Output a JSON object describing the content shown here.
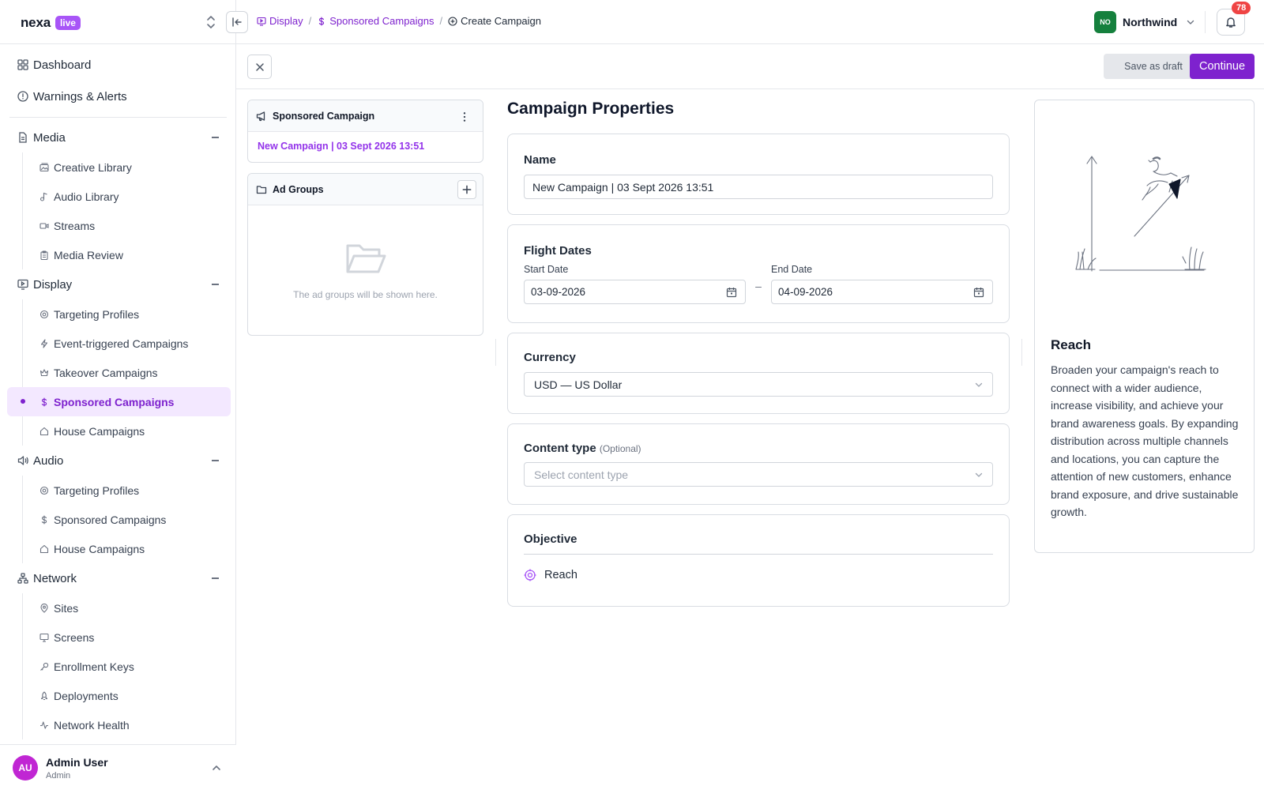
{
  "brand": {
    "name": "nexa",
    "badge": "live"
  },
  "sidebar": {
    "top_items": [
      {
        "label": "Dashboard",
        "icon": "grid-icon"
      },
      {
        "label": "Warnings & Alerts",
        "icon": "alert-circle-icon"
      }
    ],
    "groups": [
      {
        "label": "Media",
        "icon": "document-icon",
        "items": [
          {
            "label": "Creative Library",
            "icon": "image-stack-icon"
          },
          {
            "label": "Audio Library",
            "icon": "music-note-icon"
          },
          {
            "label": "Streams",
            "icon": "video-icon"
          },
          {
            "label": "Media Review",
            "icon": "clipboard-icon"
          }
        ]
      },
      {
        "label": "Display",
        "icon": "monitor-play-icon",
        "items": [
          {
            "label": "Targeting Profiles",
            "icon": "target-icon"
          },
          {
            "label": "Event-triggered Campaigns",
            "icon": "lightning-icon"
          },
          {
            "label": "Takeover Campaigns",
            "icon": "crown-icon"
          },
          {
            "label": "Sponsored Campaigns",
            "icon": "dollar-icon"
          },
          {
            "label": "House Campaigns",
            "icon": "home-icon"
          }
        ]
      },
      {
        "label": "Audio",
        "icon": "speaker-icon",
        "items": [
          {
            "label": "Targeting Profiles",
            "icon": "target-icon"
          },
          {
            "label": "Sponsored Campaigns",
            "icon": "dollar-icon"
          },
          {
            "label": "House Campaigns",
            "icon": "home-icon"
          }
        ]
      },
      {
        "label": "Network",
        "icon": "network-icon",
        "items": [
          {
            "label": "Sites",
            "icon": "map-pin-icon"
          },
          {
            "label": "Screens",
            "icon": "screen-icon"
          },
          {
            "label": "Enrollment Keys",
            "icon": "key-icon"
          },
          {
            "label": "Deployments",
            "icon": "rocket-icon"
          },
          {
            "label": "Network Health",
            "icon": "activity-icon"
          }
        ]
      }
    ],
    "active_item": "Sponsored Campaigns",
    "user": {
      "initials": "AU",
      "name": "Admin User",
      "role": "Admin"
    }
  },
  "header": {
    "breadcrumbs": [
      {
        "label": "Display",
        "icon": "monitor-play-icon"
      },
      {
        "label": "Sponsored Campaigns",
        "icon": "dollar-icon"
      },
      {
        "label": "Create Campaign",
        "icon": "plus-circle-icon"
      }
    ],
    "org": {
      "initials": "NO",
      "name": "Northwind"
    },
    "notifications": {
      "count": "78"
    }
  },
  "toolbar": {
    "save_draft": "Save as draft",
    "continue": "Continue"
  },
  "left_panel": {
    "campaign_card": {
      "title": "Sponsored Campaign",
      "campaign_name": "New Campaign | 03 Sept 2026 13:51"
    },
    "ad_groups": {
      "title": "Ad Groups",
      "empty_text": "The ad groups will be shown here."
    }
  },
  "properties": {
    "title": "Campaign Properties",
    "name": {
      "label": "Name",
      "value": "New Campaign | 03 Sept 2026 13:51"
    },
    "flight_dates": {
      "label": "Flight Dates",
      "start_label": "Start Date",
      "start_value": "03-09-2026",
      "separator": "–",
      "end_label": "End Date",
      "end_value": "04-09-2026"
    },
    "currency": {
      "label": "Currency",
      "value": "USD — US Dollar"
    },
    "content_type": {
      "label": "Content type",
      "optional": "(Optional)",
      "placeholder": "Select content type"
    },
    "objective": {
      "label": "Objective",
      "value": "Reach"
    }
  },
  "info_panel": {
    "title": "Reach",
    "body": "Broaden your campaign's reach to connect with a wider audience, increase visibility, and achieve your brand awareness goals. By expanding distribution across multiple channels and locations, you can capture the attention of new customers, enhance brand exposure, and drive sustainable growth."
  },
  "colors": {
    "accent": "#7e22ce",
    "accent_light": "#f3e8ff",
    "badge": "#a855f7",
    "org": "#15803d",
    "notification": "#ef4444"
  }
}
